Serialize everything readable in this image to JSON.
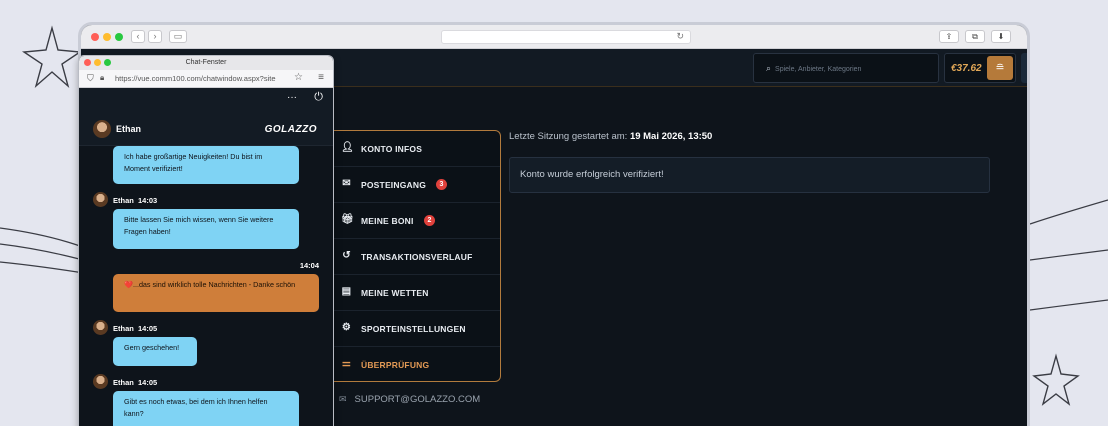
{
  "browser": {
    "traffic_lights": [
      "#ff5f57",
      "#febc2e",
      "#28c840"
    ]
  },
  "site": {
    "search_placeholder": "Spiele, Anbieter, Kategorien",
    "balance": "€37.62",
    "session_label": "Letzte Sitzung gestartet am:",
    "session_value": "19 Mai 2026, 13:50",
    "verified_message": "Konto wurde erfolgreich verifiziert!",
    "support_email": "SUPPORT@GOLAZZO.COM",
    "accent_color": "#e39a55"
  },
  "menu": {
    "items": [
      {
        "label": "KONTO INFOS",
        "icon": "user-icon",
        "badge": ""
      },
      {
        "label": "POSTEINGANG",
        "icon": "mail-icon",
        "badge": "3"
      },
      {
        "label": "MEINE BONI",
        "icon": "gift-icon",
        "badge": "2"
      },
      {
        "label": "TRANSAKTIONSVERLAUF",
        "icon": "history-icon",
        "badge": ""
      },
      {
        "label": "MEINE WETTEN",
        "icon": "ticket-icon",
        "badge": ""
      },
      {
        "label": "SPORTEINSTELLUNGEN",
        "icon": "gear-icon",
        "badge": ""
      },
      {
        "label": "ÜBERPRÜFUNG",
        "icon": "toggle-icon",
        "badge": "",
        "active": true
      }
    ]
  },
  "chat": {
    "window_title": "Chat-Fenster",
    "url": "https://vue.comm100.com/chatwindow.aspx?site",
    "agent_name": "Ethan",
    "brand": "GOLAZZO",
    "messages": [
      {
        "from": "agent",
        "text": "Ich habe großartige Neuigkeiten! Du bist im Moment verifiziert!"
      },
      {
        "from": "agent",
        "sender": "Ethan",
        "time": "14:03",
        "text": "Bitte lassen Sie mich wissen, wenn Sie weitere Fragen haben!"
      },
      {
        "from": "user",
        "time": "14:04",
        "text": "❤️...das sind wirklich tolle Nachrichten - Danke schön"
      },
      {
        "from": "agent",
        "sender": "Ethan",
        "time": "14:05",
        "text": "Gern geschehen!"
      },
      {
        "from": "agent",
        "sender": "Ethan",
        "time": "14:05",
        "text": "Gibt es noch etwas, bei dem ich Ihnen helfen kann?"
      }
    ]
  }
}
